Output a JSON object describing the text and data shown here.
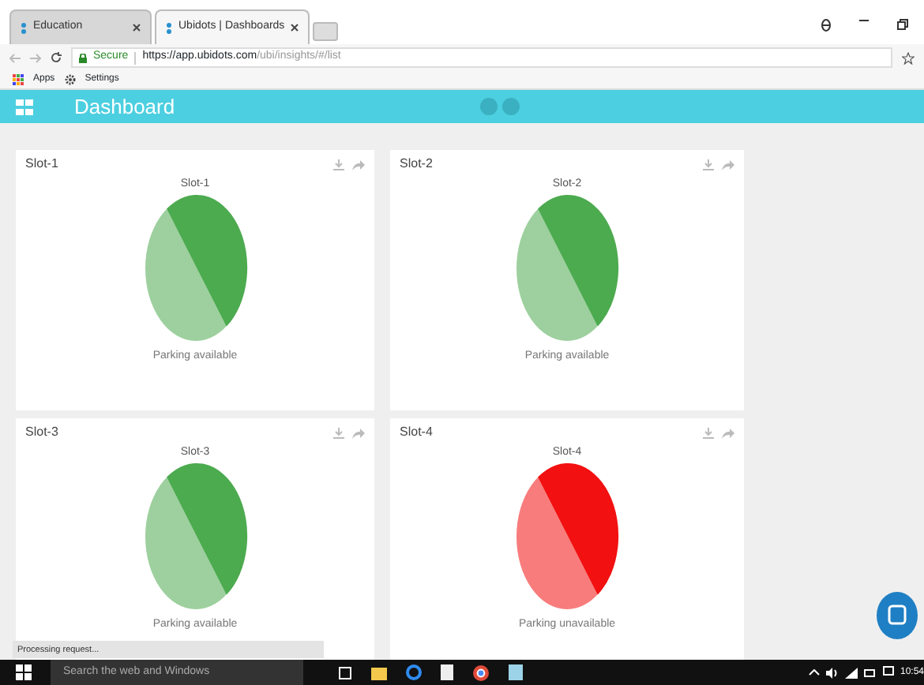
{
  "browser": {
    "tabs": [
      {
        "label": "Education",
        "selected": false
      },
      {
        "label": "Ubidots | Dashboards",
        "selected": true
      }
    ],
    "address": {
      "secure_label": "Secure",
      "url_host": "https://app.ubidots.com",
      "url_path": "/ubi/insights/#/list"
    },
    "bookmarks": [
      "Apps",
      "Settings"
    ]
  },
  "header": {
    "title": "Dashboard"
  },
  "widgets": [
    {
      "title": "Slot-1",
      "chart_title": "Slot-1",
      "status": "Parking available",
      "color": "#4caa4f"
    },
    {
      "title": "Slot-2",
      "chart_title": "Slot-2",
      "status": "Parking available",
      "color": "#4caa4f"
    },
    {
      "title": "Slot-3",
      "chart_title": "Slot-3",
      "status": "Parking available",
      "color": "#4caa4f"
    },
    {
      "title": "Slot-4",
      "chart_title": "Slot-4",
      "status": "Parking unavailable",
      "color": "#f21010"
    }
  ],
  "status_bar": "Processing request...",
  "taskbar": {
    "search_placeholder": "Search the web and Windows",
    "clock": "10:54"
  }
}
